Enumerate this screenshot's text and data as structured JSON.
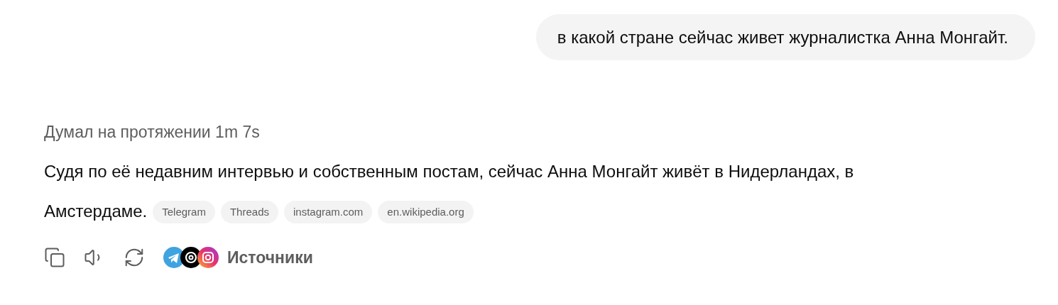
{
  "user_message": {
    "text": "в какой стране сейчас живет журналистка Анна Монгайт."
  },
  "assistant": {
    "thought_label": "Думал на протяжении 1m 7s",
    "answer": "Судя по её недавним интервью и собственным постам, сейчас Анна Монгайт живёт в Нидерландах, в Амстердаме.",
    "citations": [
      {
        "label": "Telegram"
      },
      {
        "label": "Threads"
      },
      {
        "label": "instagram.com"
      },
      {
        "label": "en.wikipedia.org"
      }
    ],
    "actions": [
      {
        "kind": "copy"
      },
      {
        "kind": "read_aloud"
      },
      {
        "kind": "regenerate"
      }
    ],
    "sources": {
      "label": "Источники",
      "icons": [
        {
          "kind": "telegram"
        },
        {
          "kind": "threads"
        },
        {
          "kind": "instagram"
        }
      ]
    }
  }
}
